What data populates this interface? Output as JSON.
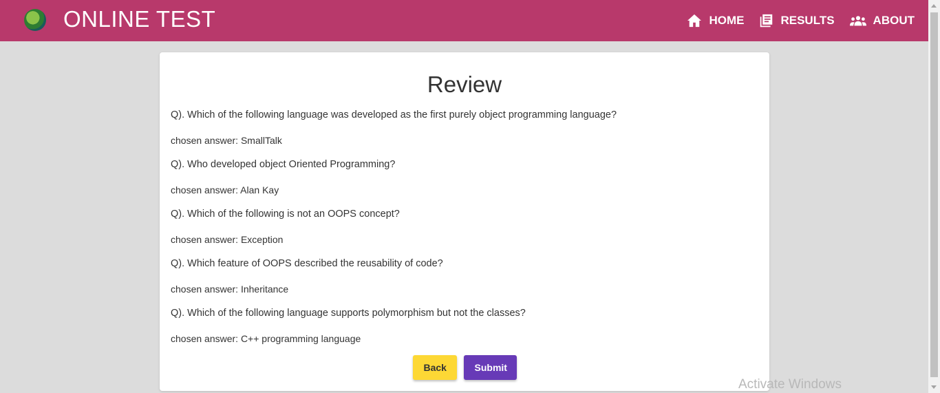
{
  "header": {
    "brand": "ONLINE TEST",
    "accent_color": "#b8396b",
    "nav": [
      {
        "label": "HOME",
        "icon": "home-icon"
      },
      {
        "label": "RESULTS",
        "icon": "results-icon"
      },
      {
        "label": "ABOUT",
        "icon": "about-icon"
      }
    ]
  },
  "review": {
    "title": "Review",
    "items": [
      {
        "question": "Q). Which of the following language was developed as the first purely object programming language?",
        "answer": "chosen answer: SmallTalk"
      },
      {
        "question": "Q). Who developed object Oriented Programming?",
        "answer": "chosen answer: Alan Kay"
      },
      {
        "question": "Q). Which of the following is not an OOPS concept?",
        "answer": "chosen answer: Exception"
      },
      {
        "question": "Q). Which feature of OOPS described the reusability of code?",
        "answer": "chosen answer: Inheritance"
      },
      {
        "question": "Q). Which of the following language supports polymorphism but not the classes?",
        "answer": "chosen answer: C++ programming language"
      }
    ],
    "back_label": "Back",
    "submit_label": "Submit"
  },
  "watermark": "Activate Windows"
}
